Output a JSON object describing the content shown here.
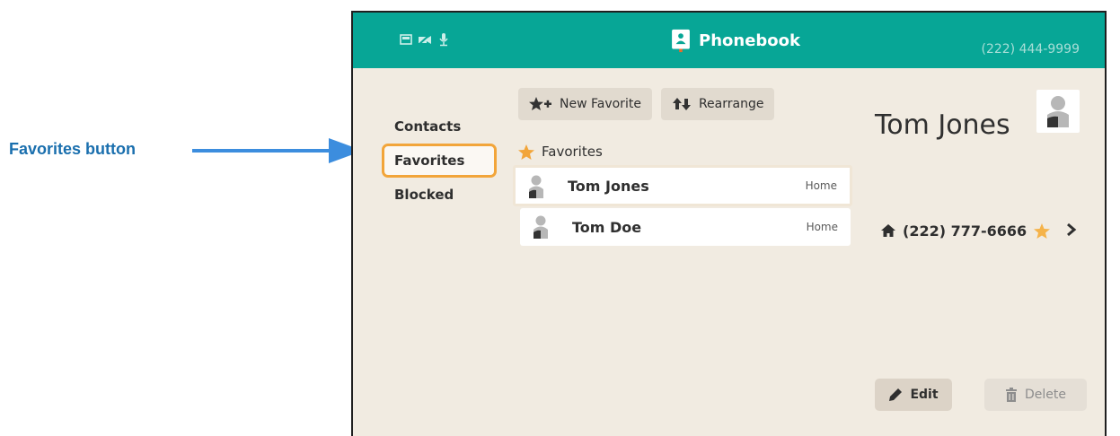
{
  "callout": {
    "label": "Favorites button"
  },
  "header": {
    "title": "Phonebook",
    "phone_number": "(222) 444-9999",
    "status_icons": [
      "inbox-icon",
      "video-off-icon",
      "microphone-icon"
    ]
  },
  "nav": {
    "items": [
      {
        "label": "Contacts",
        "active": false
      },
      {
        "label": "Favorites",
        "active": true
      },
      {
        "label": "Blocked",
        "active": false
      }
    ]
  },
  "toolbar": {
    "new_favorite_label": "New Favorite",
    "rearrange_label": "Rearrange"
  },
  "list": {
    "section_label": "Favorites",
    "rows": [
      {
        "name": "Tom Jones",
        "type": "Home"
      },
      {
        "name": "Tom Doe",
        "type": "Home"
      }
    ]
  },
  "detail": {
    "name": "Tom Jones",
    "phone": "(222) 777-6666",
    "edit_label": "Edit",
    "delete_label": "Delete"
  },
  "colors": {
    "header": "#07a696",
    "background": "#f1ebe1",
    "accent": "#f2a53a",
    "callout": "#1a6fae"
  }
}
